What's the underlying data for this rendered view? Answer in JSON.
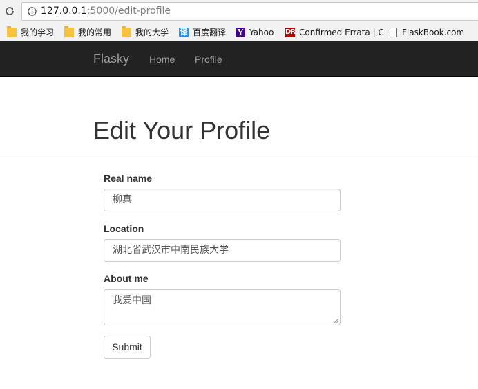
{
  "browser": {
    "url_host": "127.0.0.1",
    "url_rest": ":5000/edit-profile",
    "bookmarks": [
      {
        "label": "我的学习",
        "icon": "folder-icon"
      },
      {
        "label": "我的常用",
        "icon": "folder-icon"
      },
      {
        "label": "我的大学",
        "icon": "folder-icon"
      },
      {
        "label": "百度翻译",
        "icon": "baidu-translate-icon",
        "glyph": "译"
      },
      {
        "label": "Yahoo",
        "icon": "yahoo-icon",
        "glyph": "Y"
      },
      {
        "label": "Confirmed Errata | C",
        "icon": "oreilly-icon",
        "glyph": "DR"
      },
      {
        "label": "FlaskBook.com",
        "icon": "page-icon"
      }
    ]
  },
  "navbar": {
    "brand": "Flasky",
    "links": [
      "Home",
      "Profile"
    ]
  },
  "page": {
    "title": "Edit Your Profile"
  },
  "form": {
    "name_label": "Real name",
    "name_value": "柳真",
    "location_label": "Location",
    "location_value": "湖北省武汉市中南民族大学",
    "about_label": "About me",
    "about_value": "我爱中国",
    "submit_label": "Submit"
  }
}
